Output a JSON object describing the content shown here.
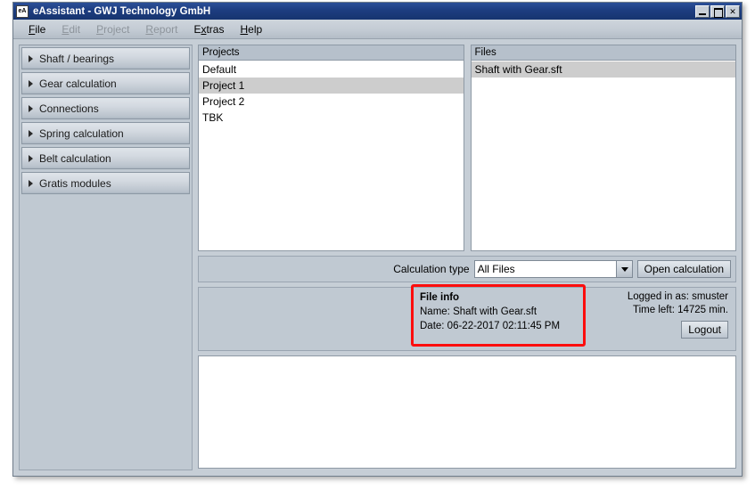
{
  "window": {
    "icon_label": "eA",
    "title": "eAssistant - GWJ Technology GmbH",
    "minimize_label": "",
    "maximize_label": "",
    "close_label": "✕"
  },
  "menubar": {
    "items": [
      {
        "label": "File",
        "accel": "F",
        "enabled": true
      },
      {
        "label": "Edit",
        "accel": "E",
        "enabled": false
      },
      {
        "label": "Project",
        "accel": "P",
        "enabled": false
      },
      {
        "label": "Report",
        "accel": "R",
        "enabled": false
      },
      {
        "label": "Extras",
        "accel": "x",
        "enabled": true
      },
      {
        "label": "Help",
        "accel": "H",
        "enabled": true
      }
    ]
  },
  "sidebar": {
    "items": [
      {
        "label": "Shaft / bearings"
      },
      {
        "label": "Gear calculation"
      },
      {
        "label": "Connections"
      },
      {
        "label": "Spring calculation"
      },
      {
        "label": "Belt calculation"
      },
      {
        "label": "Gratis modules"
      }
    ]
  },
  "projects_panel": {
    "header": "Projects",
    "rows": [
      {
        "label": "Default",
        "selected": false
      },
      {
        "label": "Project 1",
        "selected": true
      },
      {
        "label": "Project 2",
        "selected": false
      },
      {
        "label": "TBK",
        "selected": false
      }
    ]
  },
  "files_panel": {
    "header": "Files",
    "rows": [
      {
        "label": "Shaft with Gear.sft",
        "selected": true
      }
    ]
  },
  "calculation_type": {
    "label": "Calculation type",
    "selected_value": "All Files",
    "options": [
      "All Files"
    ],
    "open_button": "Open calculation"
  },
  "file_info": {
    "title": "File info",
    "name_line": "Name: Shaft with Gear.sft",
    "date_line": "Date: 06-22-2017 02:11:45 PM"
  },
  "login": {
    "logged_in": "Logged in as: smuster",
    "time_left": "Time left: 14725 min.",
    "logout_button": "Logout"
  },
  "colors": {
    "titlebar": "#1d3d80",
    "window_bg": "#c6ced6",
    "panel_bg": "#c0c9d2",
    "list_selected": "#cdcdcd",
    "annotation_red": "#fc0d0d",
    "border": "#8e99a5"
  }
}
